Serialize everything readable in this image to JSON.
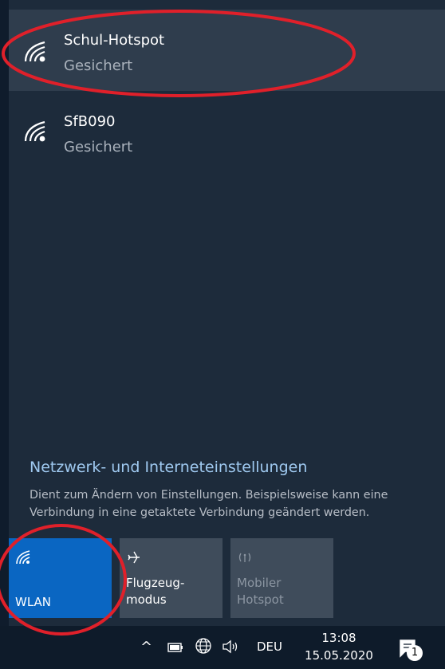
{
  "networks": [
    {
      "name": "Schul-Hotspot",
      "status": "Gesichert",
      "icon": "wifi-icon"
    },
    {
      "name": "SfB090",
      "status": "Gesichert",
      "icon": "wifi-icon"
    }
  ],
  "settings": {
    "title": "Netzwerk- und Interneteinstellungen",
    "description": "Dient zum Ändern von Einstellungen. Beispielsweise kann eine Verbindung in eine getaktete Verbindung geändert werden."
  },
  "quick_actions": [
    {
      "label": "WLAN",
      "icon": "wifi-icon",
      "active": true
    },
    {
      "label": "Flugzeug-\nmodus",
      "icon": "airplane-icon",
      "active": false
    },
    {
      "label": "Mobiler\nHotspot",
      "icon": "hotspot-icon",
      "active": false
    }
  ],
  "taskbar": {
    "chevron": "^",
    "language": "DEU",
    "time": "13:08",
    "date": "15.05.2020",
    "notification_count": "1"
  },
  "colors": {
    "flyout_bg": "#1d2b3b",
    "selected_bg": "#2f3d4d",
    "accent": "#0a66c2",
    "link": "#9fc9f0",
    "annotation": "#e0202a"
  }
}
